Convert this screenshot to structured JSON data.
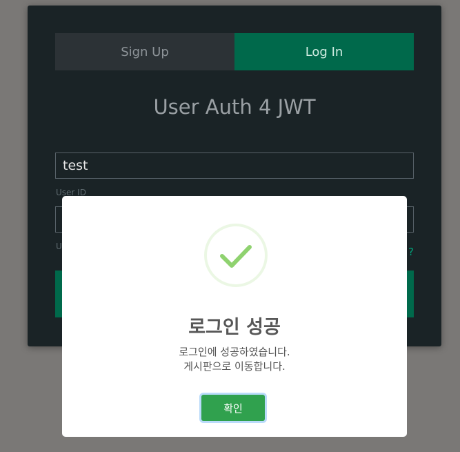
{
  "auth": {
    "tabs": [
      {
        "label": "Sign Up",
        "active": false
      },
      {
        "label": "Log In",
        "active": true
      }
    ],
    "title": "User Auth 4 JWT",
    "user_id": {
      "value": "test",
      "label": "User ID"
    },
    "password": {
      "value": "",
      "label": "U"
    },
    "forgot_link_text": "?"
  },
  "modal": {
    "icon": "check-icon",
    "title": "로그인 성공",
    "message_lines": [
      "로그인에 성공하였습니다.",
      "게시판으로 이동합니다."
    ],
    "confirm_label": "확인"
  },
  "colors": {
    "background": "#7a7876",
    "card": "#1a2326",
    "accent": "#00694b",
    "success": "#a5dc86",
    "confirm": "#30a14e"
  }
}
